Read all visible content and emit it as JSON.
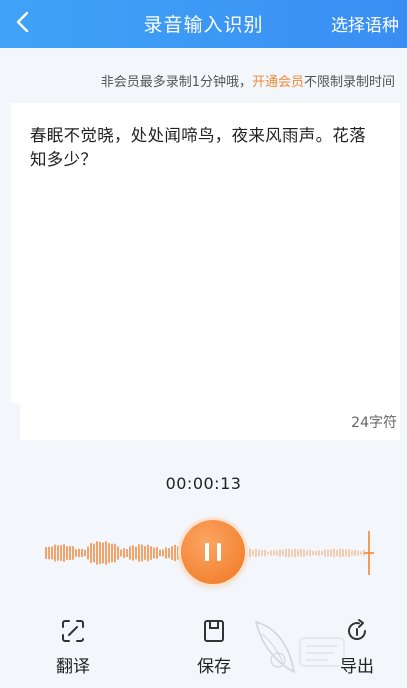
{
  "header": {
    "title": "录音输入识别",
    "language_button": "选择语种",
    "icons": {
      "back": "chevron-left-icon"
    },
    "colors": {
      "start": "#3fa3f7",
      "end": "#3a8ef3"
    }
  },
  "notice": {
    "prefix": "非会员最多录制1分钟哦，",
    "link": "开通会员",
    "suffix": "不限制录制时间"
  },
  "transcript": {
    "text": "春眠不觉晓，处处闻啼鸟，夜来风雨声。花落知多少？",
    "char_count": "24字符"
  },
  "recorder": {
    "elapsed": "00:00:13",
    "state": "recording",
    "accent_color": "#f38534",
    "icons": {
      "control": "pause-icon"
    }
  },
  "actions": [
    {
      "label": "翻译",
      "icon": "translate-icon"
    },
    {
      "label": "保存",
      "icon": "save-icon"
    },
    {
      "label": "导出",
      "icon": "export-icon"
    }
  ]
}
